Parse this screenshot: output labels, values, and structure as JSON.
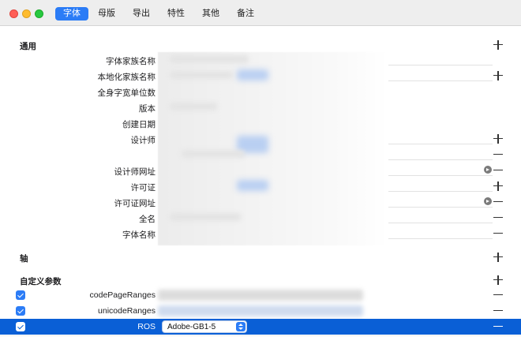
{
  "tabs": [
    {
      "label": "字体",
      "active": true
    },
    {
      "label": "母版",
      "active": false
    },
    {
      "label": "导出",
      "active": false
    },
    {
      "label": "特性",
      "active": false
    },
    {
      "label": "其他",
      "active": false
    },
    {
      "label": "备注",
      "active": false
    }
  ],
  "general": {
    "title": "通用",
    "fields": [
      {
        "label": "字体家族名称"
      },
      {
        "label": "本地化家族名称"
      },
      {
        "label": "全身字宽单位数"
      },
      {
        "label": "版本"
      },
      {
        "label": "创建日期"
      },
      {
        "label": "设计师"
      },
      {
        "label": "设计师网址"
      },
      {
        "label": "许可证"
      },
      {
        "label": "许可证网址"
      },
      {
        "label": "全名"
      },
      {
        "label": "字体名称"
      }
    ]
  },
  "axes": {
    "title": "轴"
  },
  "custom_params": {
    "title": "自定义参数",
    "rows": [
      {
        "name": "codePageRanges",
        "checked": true
      },
      {
        "name": "unicodeRanges",
        "checked": true
      },
      {
        "name": "ROS",
        "checked": true,
        "selected": true,
        "value": "Adobe-GB1-5"
      }
    ]
  },
  "icons": {
    "add": "plus-icon",
    "remove": "minus-icon",
    "go": "arrow-circle-icon"
  },
  "colors": {
    "accent": "#2b7cf6",
    "selection": "#0a5fd6"
  }
}
